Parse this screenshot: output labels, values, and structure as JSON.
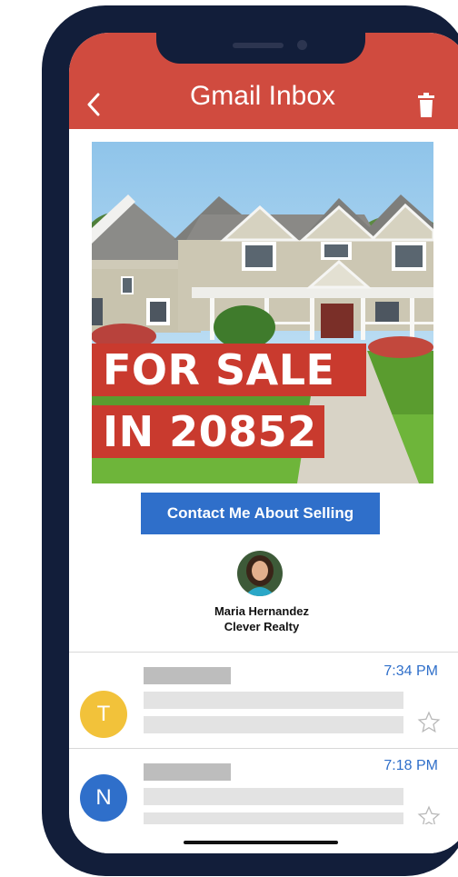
{
  "header": {
    "title": "Gmail Inbox",
    "back_icon": "chevron-left-icon",
    "trash_icon": "trash-icon",
    "color": "#d04b3f"
  },
  "email": {
    "hero_overlay_line1": "FOR SALE",
    "hero_overlay_line2": "IN 20852",
    "cta_label": "Contact Me About Selling",
    "agent_name": "Maria Hernandez",
    "agent_company": "Clever Realty",
    "cta_color": "#2f6fca"
  },
  "inbox": [
    {
      "avatar_letter": "T",
      "avatar_color": "#f2c23a",
      "time": "7:34 PM"
    },
    {
      "avatar_letter": "N",
      "avatar_color": "#2f6fca",
      "time": "7:18 PM"
    }
  ]
}
